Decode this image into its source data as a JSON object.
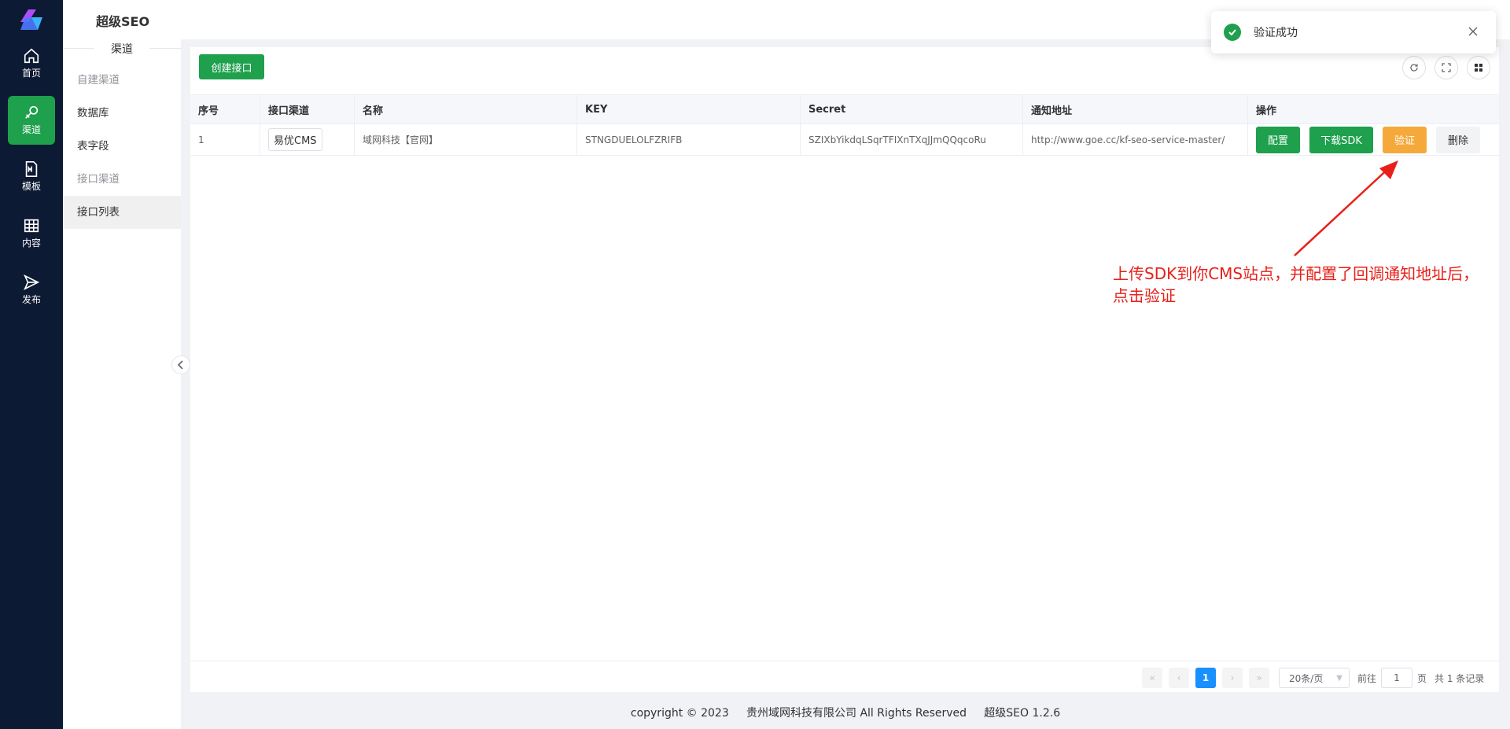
{
  "app": {
    "title": "超级SEO"
  },
  "nav": {
    "items": [
      {
        "label": "首页",
        "icon": "home-icon"
      },
      {
        "label": "渠道",
        "icon": "link-icon"
      },
      {
        "label": "模板",
        "icon": "template-icon"
      },
      {
        "label": "内容",
        "icon": "grid-icon"
      },
      {
        "label": "发布",
        "icon": "send-icon"
      }
    ],
    "active": "渠道"
  },
  "subnav": {
    "group": "渠道",
    "items": [
      {
        "label": "自建渠道",
        "muted": true
      },
      {
        "label": "数据库"
      },
      {
        "label": "表字段"
      },
      {
        "label": "接口渠道",
        "muted": true
      },
      {
        "label": "接口列表",
        "active": true
      }
    ]
  },
  "toolbar": {
    "create_label": "创建接口"
  },
  "table": {
    "columns": [
      "序号",
      "接口渠道",
      "名称",
      "KEY",
      "Secret",
      "通知地址",
      "操作"
    ],
    "rows": [
      {
        "index": "1",
        "channel": "易优CMS",
        "name": "域网科技【官网】",
        "key": "STNGDUELOLFZRIFB",
        "secret": "SZIXbYikdqLSqrTFIXnTXqJJmQQqcoRu",
        "notify_url": "http://www.goe.cc/kf-seo-service-master/"
      }
    ],
    "actions": {
      "config": "配置",
      "download": "下载SDK",
      "verify": "验证",
      "delete": "删除"
    }
  },
  "annotation": {
    "line1": "上传SDK到你CMS站点，并配置了回调通知地址后，",
    "line2": "点击验证"
  },
  "pagination": {
    "current": "1",
    "page_size": "20条/页",
    "goto_prefix": "前往",
    "goto_value": "1",
    "goto_suffix": "页",
    "total": "共 1 条记录"
  },
  "footer": {
    "copyright": "copyright © 2023",
    "company": "贵州域网科技有限公司 All Rights Reserved",
    "version": "超级SEO 1.2.6"
  },
  "toast": {
    "message": "验证成功"
  },
  "colors": {
    "primary": "#1ea04d",
    "warning": "#f6a93b",
    "sidebar": "#0d1a33",
    "annotation": "#e8201a"
  }
}
